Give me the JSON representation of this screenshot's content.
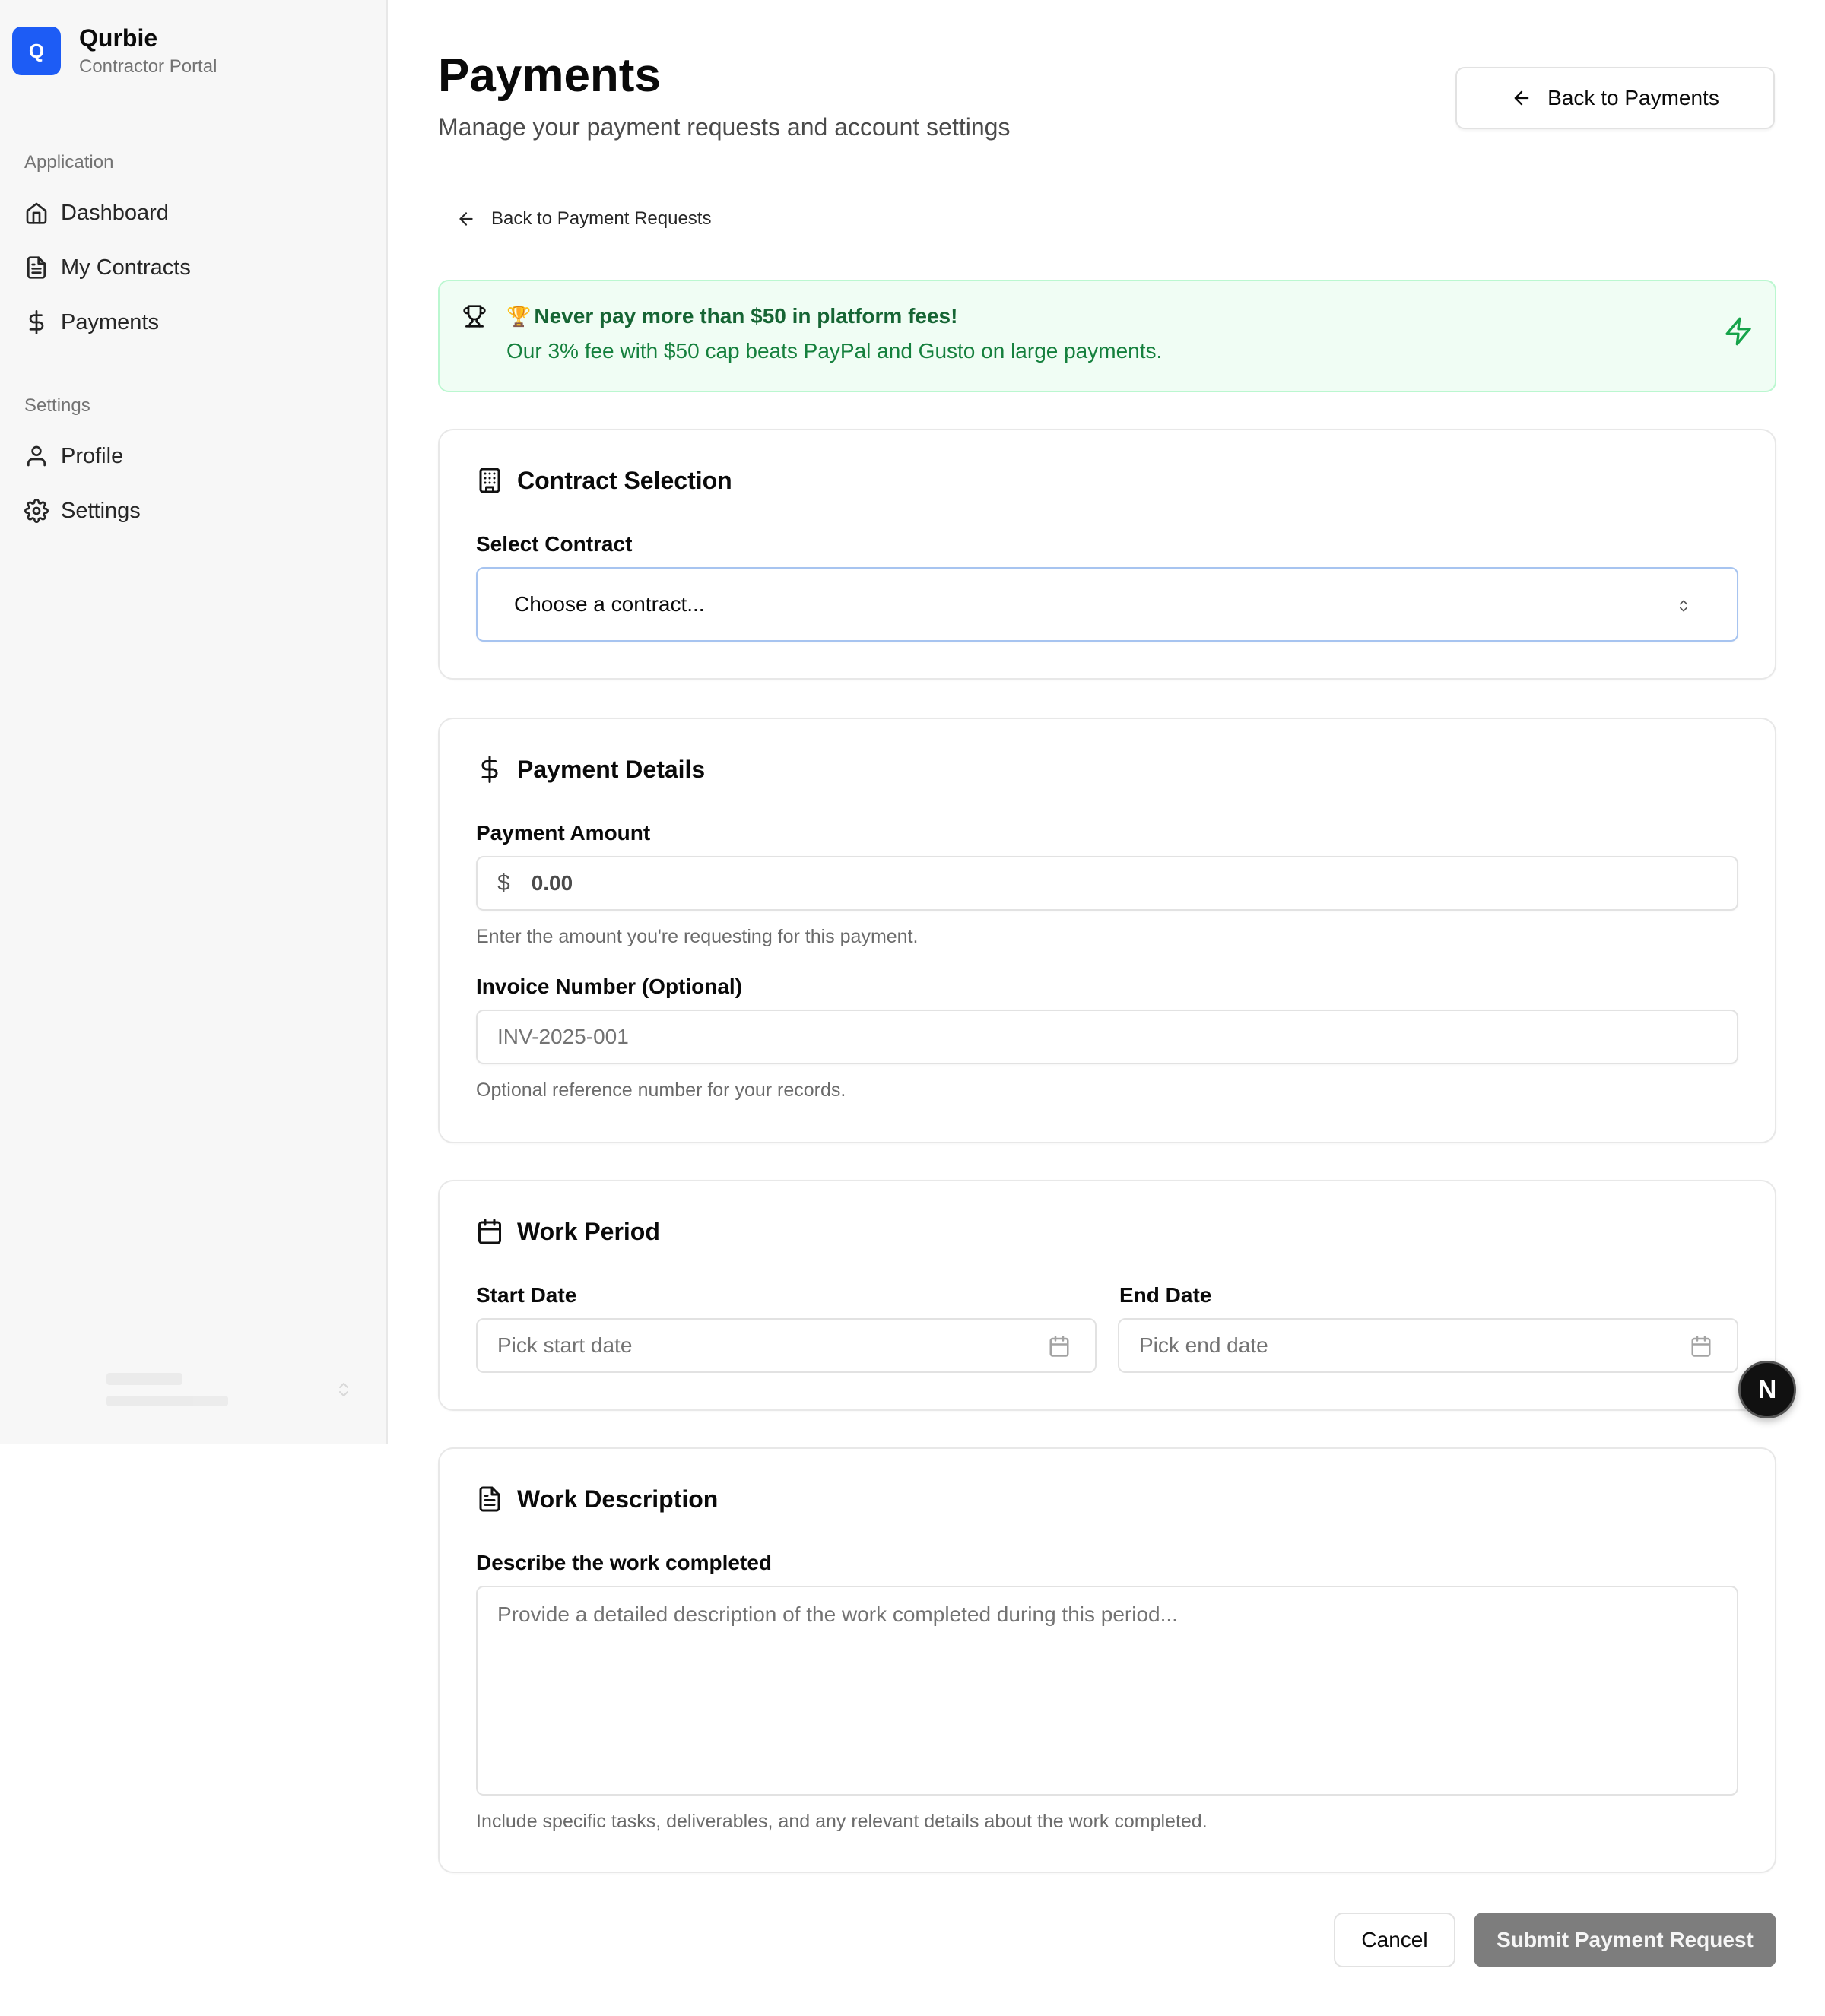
{
  "brand": {
    "logo_letter": "Q",
    "name": "Qurbie",
    "subtitle": "Contractor Portal",
    "accent": "#1d5cf5"
  },
  "sidebar": {
    "groups": [
      {
        "label": "Application",
        "items": [
          {
            "label": "Dashboard",
            "icon": "home-icon"
          },
          {
            "label": "My Contracts",
            "icon": "file-text-icon"
          },
          {
            "label": "Payments",
            "icon": "dollar-icon"
          }
        ]
      },
      {
        "label": "Settings",
        "items": [
          {
            "label": "Profile",
            "icon": "user-icon"
          },
          {
            "label": "Settings",
            "icon": "gear-icon"
          }
        ]
      }
    ]
  },
  "header": {
    "title": "Payments",
    "subtitle": "Manage your payment requests and account settings",
    "back_button": "Back to Payments"
  },
  "back_link": "Back to Payment Requests",
  "promo": {
    "emoji": "🏆",
    "title": "Never pay more than $50 in platform fees!",
    "text": "Our 3% fee with $50 cap beats PayPal and Gusto on large payments.",
    "color": "#16a34a"
  },
  "contract_section": {
    "title": "Contract Selection",
    "label": "Select Contract",
    "placeholder": "Choose a contract..."
  },
  "payment_section": {
    "title": "Payment Details",
    "amount_label": "Payment Amount",
    "currency_symbol": "$",
    "amount_placeholder": "0.00",
    "amount_hint": "Enter the amount you're requesting for this payment.",
    "invoice_label": "Invoice Number (Optional)",
    "invoice_placeholder": "INV-2025-001",
    "invoice_hint": "Optional reference number for your records."
  },
  "work_period": {
    "title": "Work Period",
    "start_label": "Start Date",
    "start_placeholder": "Pick start date",
    "end_label": "End Date",
    "end_placeholder": "Pick end date"
  },
  "work_description": {
    "title": "Work Description",
    "label": "Describe the work completed",
    "placeholder": "Provide a detailed description of the work completed during this period...",
    "hint": "Include specific tasks, deliverables, and any relevant details about the work completed."
  },
  "actions": {
    "cancel": "Cancel",
    "submit": "Submit Payment Request"
  },
  "dev_badge": "N"
}
